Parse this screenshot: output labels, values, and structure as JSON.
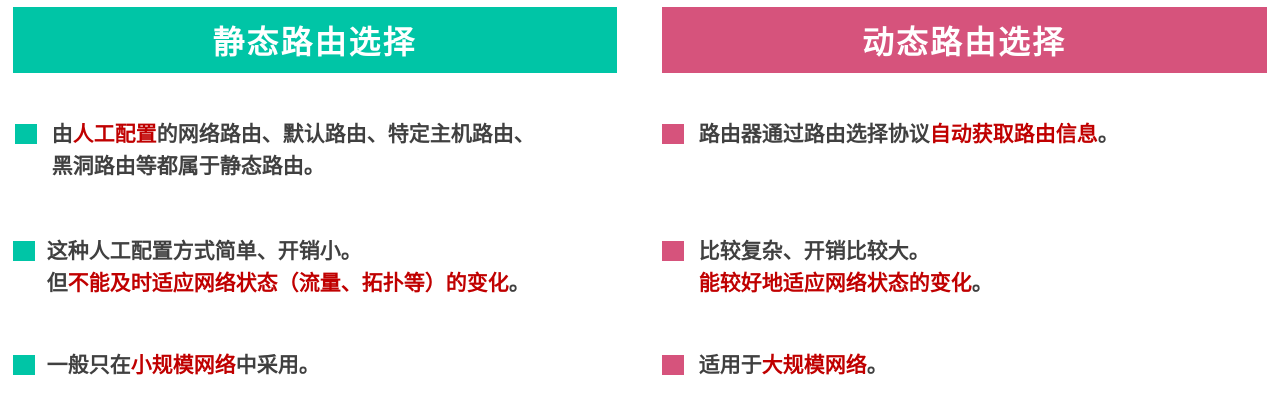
{
  "colors": {
    "static_header": "#00C5A6",
    "dynamic_header": "#D6537C",
    "highlight": "#C00000",
    "body_text": "#404040"
  },
  "static": {
    "title": "静态路由选择",
    "b1": {
      "pre": "由",
      "hl": "人工配置",
      "post": "的网络路由、默认路由、特定主机路由、",
      "line2": "黑洞路由等都属于静态路由。"
    },
    "b2": {
      "line1": "这种人工配置方式简单、开销小。",
      "pre": "但",
      "hl": "不能及时适应网络状态（流量、拓扑等）的变化",
      "post": "。"
    },
    "b3": {
      "pre": "一般只在",
      "hl": "小规模网络",
      "post": "中采用。"
    }
  },
  "dynamic": {
    "title": "动态路由选择",
    "b1": {
      "pre": "路由器通过路由选择协议",
      "hl": "自动获取路由信息",
      "post": "。"
    },
    "b2": {
      "line1": "比较复杂、开销比较大。",
      "hl": "能较好地适应网络状态的变化",
      "post": "。"
    },
    "b3": {
      "pre": "适用于",
      "hl": "大规模网络",
      "post": "。"
    }
  }
}
